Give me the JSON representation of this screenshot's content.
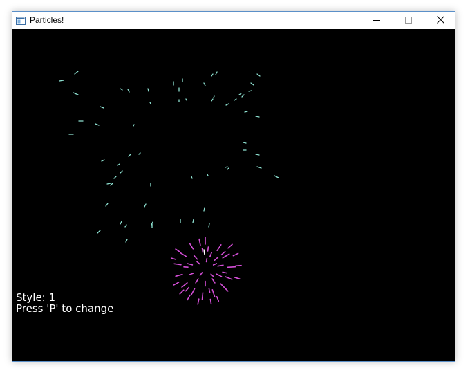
{
  "window": {
    "title": "Particles!",
    "title_icon": "app-window-icon",
    "controls": {
      "minimize_icon": "minimize-icon",
      "maximize_icon": "maximize-icon",
      "close_icon": "close-icon"
    }
  },
  "game": {
    "background_color": "#000000",
    "style_text": "Style: 1",
    "hint_text": "Press 'P' to change",
    "colors": {
      "cyan_particles": "#8fe3d3",
      "magenta_particles": "#d54fd8",
      "hud_text": "#ffffff"
    }
  }
}
